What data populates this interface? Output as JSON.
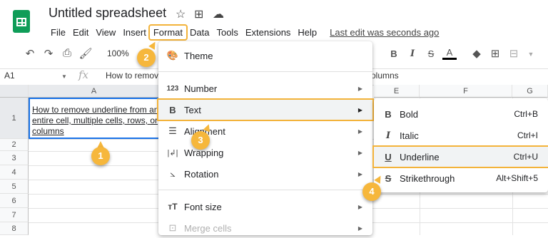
{
  "app": {
    "title": "Untitled spreadsheet",
    "last_edit": "Last edit was seconds ago"
  },
  "menubar": [
    "File",
    "Edit",
    "View",
    "Insert",
    "Format",
    "Data",
    "Tools",
    "Extensions",
    "Help"
  ],
  "toolbar": {
    "zoom": "100%"
  },
  "formula_bar": {
    "cell_ref": "A1",
    "fx": "fx",
    "content_left": "How to remov",
    "content_right": "olumns"
  },
  "columns": [
    "A",
    "E",
    "F",
    "G"
  ],
  "rows": [
    "1",
    "2",
    "3",
    "4",
    "5",
    "6",
    "7",
    "8"
  ],
  "cell_a1": "How to remove underline from an entire cell, multiple cells, rows, or columns",
  "format_menu": {
    "theme": "Theme",
    "number": "Number",
    "text": "Text",
    "alignment": "Alignment",
    "wrapping": "Wrapping",
    "rotation": "Rotation",
    "font_size": "Font size",
    "merge_cells": "Merge cells"
  },
  "text_submenu": {
    "bold": {
      "label": "Bold",
      "shortcut": "Ctrl+B"
    },
    "italic": {
      "label": "Italic",
      "shortcut": "Ctrl+I"
    },
    "underline": {
      "label": "Underline",
      "shortcut": "Ctrl+U"
    },
    "strikethrough": {
      "label": "Strikethrough",
      "shortcut": "Alt+Shift+5"
    }
  },
  "steps": [
    "1",
    "2",
    "3",
    "4"
  ],
  "colors": {
    "accent_highlight": "#f3b33a",
    "badge": "#f6b73c",
    "selection": "#1a73e8",
    "sheets_green": "#0f9d58"
  }
}
